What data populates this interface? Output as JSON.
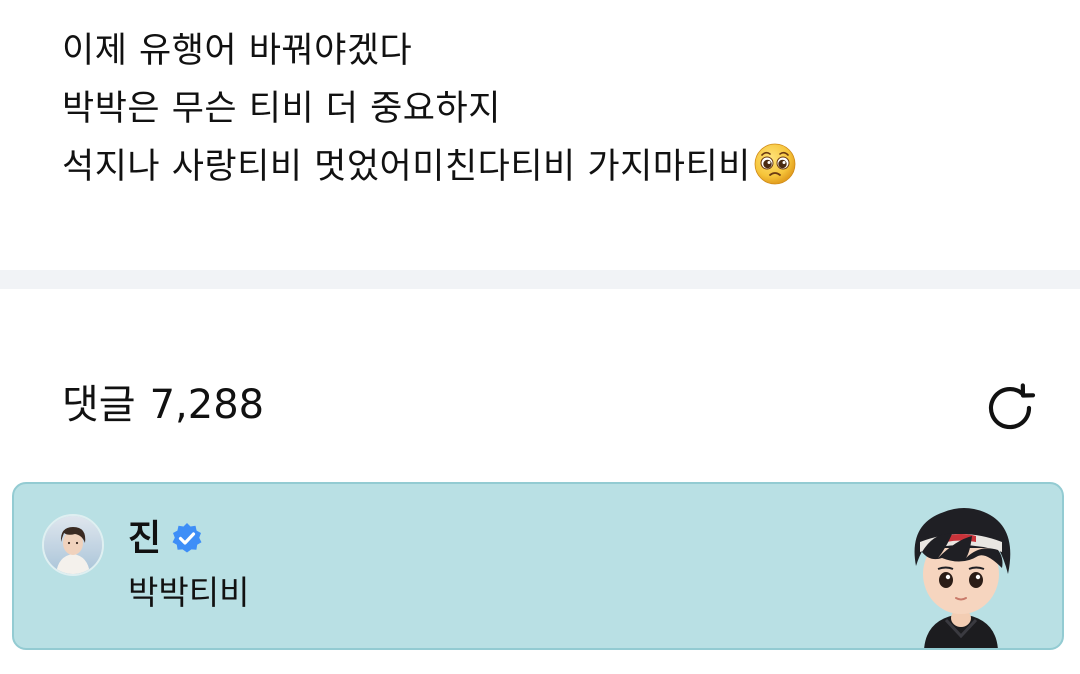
{
  "post": {
    "lines": [
      "이제 유행어 바꿔야겠다",
      "박박은 무슨 티비 더 중요하지",
      "석지나 사랑티비 멋었어미친다티비 가지마티비"
    ],
    "trailing_emoji": "pleading-face-emoji"
  },
  "comments": {
    "label": "댓글",
    "count": "7,288",
    "refresh_icon": "refresh-icon"
  },
  "pinned_comment": {
    "author": "진",
    "verified_icon": "verified-badge-icon",
    "text": "박박티비",
    "background_color": "#b9e0e4",
    "sticker": "character-sticker"
  }
}
